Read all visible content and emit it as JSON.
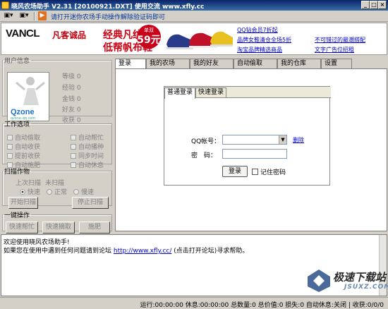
{
  "window": {
    "title": "晓风农场助手 V2.31 [20100921.DXT]   使用交流 www.xfly.cc",
    "min": "_",
    "max": "□",
    "close": "×"
  },
  "toolbar": {
    "btn1": "▣▾",
    "btn2": "▣▾",
    "btn3": "▶",
    "help": "请打开迷你农场手动操作解除验证码即可"
  },
  "ad": {
    "brand": "VANCL",
    "brand_cn": "凡客诚品",
    "headline1": "经典凡纹底",
    "headline2": "低帮帆布鞋",
    "price_label": "单双",
    "price": "59元",
    "links": [
      "QQ钻会员7折起",
      "品牌女鞋清仓全场5折",
      "淘宝品牌精选商品",
      "不可错过的最潮搭配",
      "文字广告位招租"
    ]
  },
  "user": {
    "legend": "用户信息",
    "logo": "Qzone",
    "logo_sub": "qzone.qq.com",
    "stats": [
      "等级 0",
      "经验 0",
      "金钱 0",
      "好友 0",
      "收获 0"
    ]
  },
  "work": {
    "legend": "工作选项",
    "left": [
      "自动偷取",
      "自动收获",
      "提前收获",
      "自动施肥"
    ],
    "right": [
      "自动帮忙",
      "自动播种",
      "同步时间",
      "自动休息"
    ]
  },
  "scan": {
    "legend": "扫描作物",
    "last": "上次扫描",
    "last_value": "未扫描",
    "speeds": [
      "快速",
      "正常",
      "慢速"
    ],
    "start": "开始扫描",
    "stop": "停止扫描"
  },
  "oneclick": {
    "legend": "一键操作",
    "buttons": [
      "快速帮忙",
      "快速摘取",
      "施肥"
    ]
  },
  "tabs": [
    "登录",
    "我的农场",
    "我的好友",
    "自动偷取",
    "我的仓库",
    "设置"
  ],
  "login": {
    "tab_normal": "普通登录",
    "tab_fast": "快速登录",
    "qq_label": "QQ帐号：",
    "pwd_label": "密　码：",
    "delete": "删除",
    "button": "登录",
    "remember": "记住密码"
  },
  "log": {
    "line1": "欢迎使用晓风农场助手!",
    "line2_pre": "如果您在使用中遇到任何问题请到论坛",
    "line2_link": "http://www.xfly.cc/",
    "line2_post": "(点击打开论坛)寻求帮助。"
  },
  "watermark": {
    "main": "极速下载站",
    "sub": "JSUXZ.COM"
  },
  "status": "运行:00:00:00 休息:00:00:00 总数量:0 总价值:0 损失:0 自动休息:关闭 | 收获:0/0/0"
}
